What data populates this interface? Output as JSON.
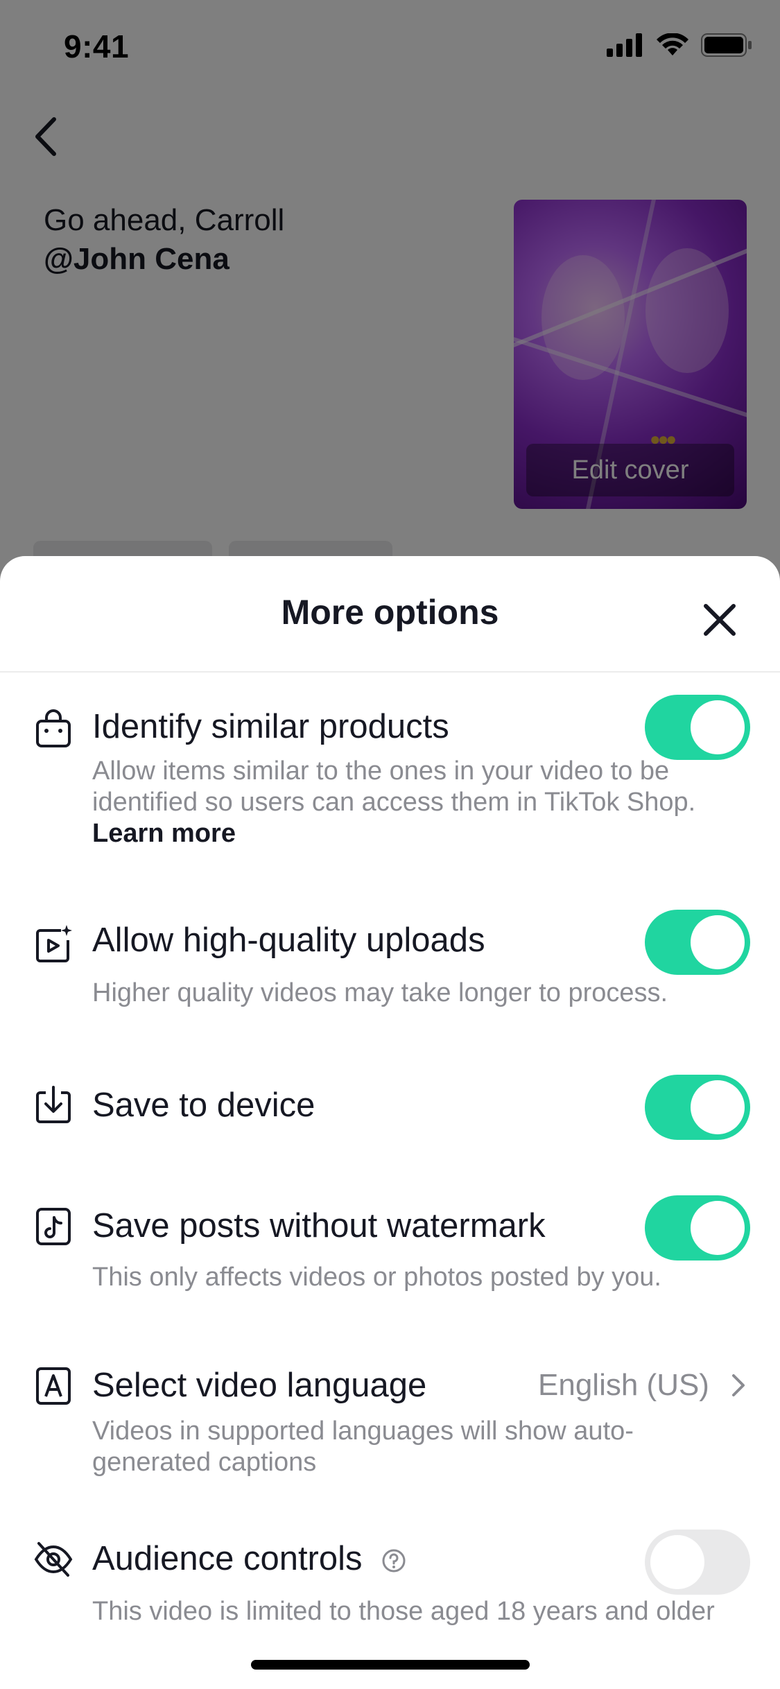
{
  "status_bar": {
    "time": "9:41"
  },
  "background": {
    "caption": "Go ahead, Carroll",
    "mention": "@John Cena",
    "edit_cover_label": "Edit cover"
  },
  "sheet": {
    "title": "More options",
    "options": [
      {
        "title": "Identify similar products",
        "description": "Allow items similar to the ones in your video to be identified so users can access them in TikTok Shop.",
        "link": "Learn more",
        "enabled": true,
        "icon": "shopping-bag-icon"
      },
      {
        "title": "Allow high-quality uploads",
        "description": "Higher quality videos may take longer to process.",
        "enabled": true,
        "icon": "hq-video-icon"
      },
      {
        "title": "Save to device",
        "enabled": true,
        "icon": "download-icon"
      },
      {
        "title": "Save posts without watermark",
        "description": "This only affects videos or photos posted by you.",
        "enabled": true,
        "icon": "tiktok-note-icon"
      },
      {
        "title": "Select video language",
        "value": "English (US)",
        "description": "Videos in supported languages will show auto-generated captions",
        "icon": "language-a-icon"
      },
      {
        "title": "Audience controls",
        "description": "This video is limited to those aged 18 years and older",
        "enabled": false,
        "icon": "eye-slash-icon"
      }
    ]
  },
  "colors": {
    "toggle_on": "#20d5a0",
    "toggle_off": "#e9e9ea",
    "secondary_text": "#8a8b91"
  }
}
